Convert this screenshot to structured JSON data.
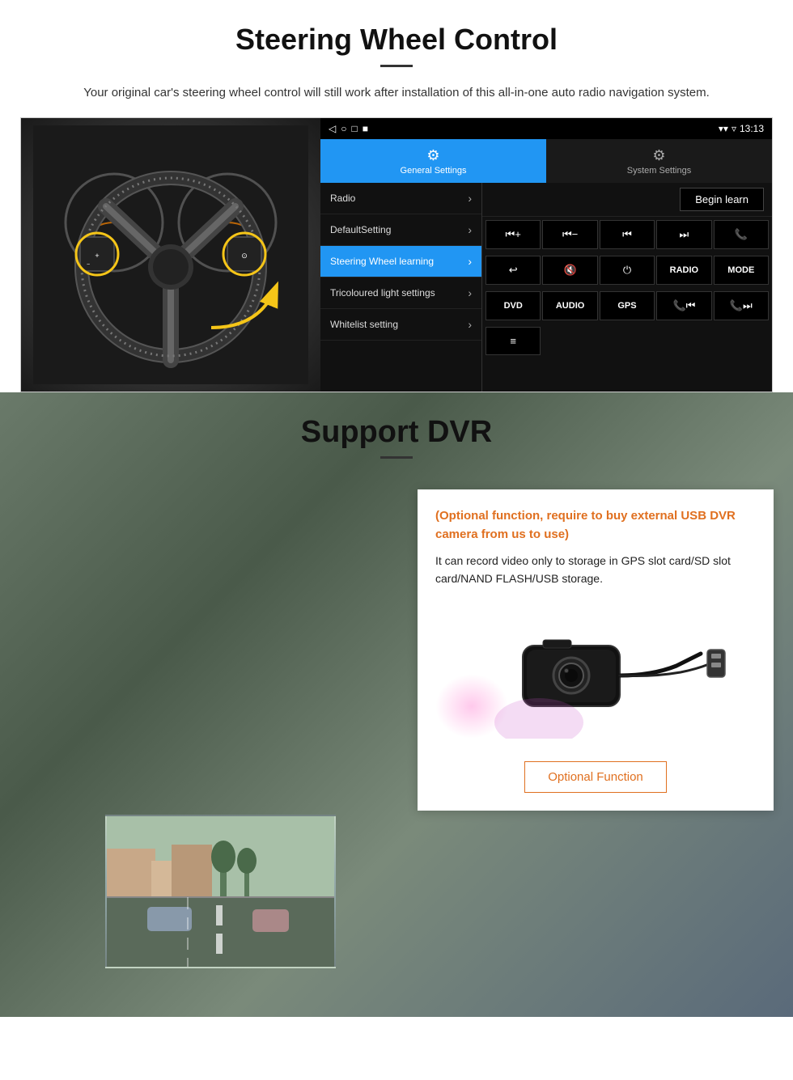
{
  "page": {
    "section1": {
      "title": "Steering Wheel Control",
      "subtitle": "Your original car's steering wheel control will still work after installation of this all-in-one auto radio navigation system.",
      "statusbar": {
        "time": "13:13",
        "icons": [
          "◁",
          "○",
          "□",
          "■"
        ]
      },
      "tabs": {
        "general": {
          "label": "General Settings",
          "icon": "⚙"
        },
        "system": {
          "label": "System Settings",
          "icon": "⚙"
        }
      },
      "settings_items": [
        {
          "label": "Radio",
          "active": false
        },
        {
          "label": "DefaultSetting",
          "active": false
        },
        {
          "label": "Steering Wheel learning",
          "active": true
        },
        {
          "label": "Tricoloured light settings",
          "active": false
        },
        {
          "label": "Whitelist setting",
          "active": false
        }
      ],
      "begin_learn": "Begin learn",
      "control_buttons_row1": [
        "⏮+",
        "⏮-",
        "⏮",
        "⏭",
        "📞"
      ],
      "control_buttons_row2": [
        "↩",
        "🔇",
        "⏻",
        "RADIO",
        "MODE"
      ],
      "control_buttons_row3": [
        "DVD",
        "AUDIO",
        "GPS",
        "📞⏮",
        "📞⏭"
      ],
      "control_buttons_row4": [
        "≡"
      ]
    },
    "section2": {
      "title": "Support DVR",
      "optional_text": "(Optional function, require to buy external USB DVR camera from us to use)",
      "description": "It can record video only to storage in GPS slot card/SD slot card/NAND FLASH/USB storage.",
      "optional_button_label": "Optional Function"
    }
  }
}
